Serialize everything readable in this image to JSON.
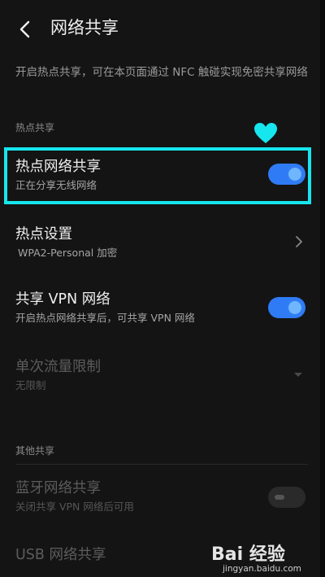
{
  "header": {
    "title": "网络共享"
  },
  "description": "开启热点共享，可在本页面通过 NFC 触碰实现免密共享网络",
  "sections": {
    "hotspot_label": "热点共享",
    "other_label": "其他共享"
  },
  "rows": {
    "hotspot_share": {
      "title": "热点网络共享",
      "subtitle": "正在分享无线网络",
      "enabled": true
    },
    "hotspot_settings": {
      "title": "热点设置",
      "subtitle": "WPA2-Personal 加密"
    },
    "vpn_share": {
      "title": "共享 VPN 网络",
      "subtitle": "开启热点网络共享后，可共享 VPN 网络",
      "enabled": true
    },
    "traffic_limit": {
      "title": "单次流量限制",
      "subtitle": "无限制"
    },
    "bluetooth_share": {
      "title": "蓝牙网络共享",
      "subtitle": "关闭共享 VPN 网络后可用",
      "enabled": false
    },
    "usb_share": {
      "title": "USB 网络共享"
    }
  },
  "watermark": {
    "brand": "Bai 经验",
    "url": "jingyan.baidu.com"
  },
  "colors": {
    "accent": "#2f7bf5",
    "highlight": "#16e6ee",
    "background": "#141414"
  }
}
